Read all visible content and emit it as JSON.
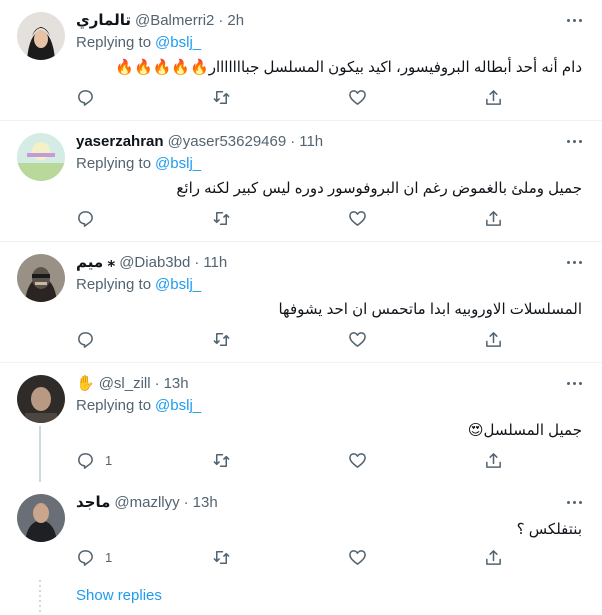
{
  "replying_label": "Replying to",
  "show_replies": "Show replies",
  "tweets": [
    {
      "name": "تالماري",
      "handle": "@Balmerri2",
      "time": "2h",
      "reply_to": "@bslj_",
      "text": "دام أنه أحد أبطاله البروفيسور، اكيد بيكون المسلسل جبااااااار🔥🔥🔥🔥🔥",
      "replies": "",
      "avatar_bg": "#d8d4cf"
    },
    {
      "name": "yaserzahran",
      "handle": "@yaser53629469",
      "time": "11h",
      "reply_to": "@bslj_",
      "text": "جميل وملئ بالغموض رغم ان البروفوسور دوره ليس كبير لكنه رائع",
      "replies": "",
      "avatar_bg": "#cfe9df"
    },
    {
      "name": "ميم ⁎",
      "handle": "@Diab3bd",
      "time": "11h",
      "reply_to": "@bslj_",
      "text": "المسلسلات الاوروبيه ابدا ماتحمس ان احد يشوفها",
      "replies": "",
      "avatar_bg": "#8b8378"
    },
    {
      "name": "",
      "handle": "@sl_zill",
      "time": "13h",
      "reply_to": "@bslj_",
      "text": "جميل المسلسل😍",
      "replies": "1",
      "avatar_bg": "#2d2a28"
    },
    {
      "name": "ماجد",
      "handle": "@mazllyy",
      "time": "13h",
      "reply_to": "",
      "text": "بنتفلكس ؟",
      "replies": "1",
      "avatar_bg": "#4a4e56"
    }
  ],
  "colors": {
    "link": "#1d9bf0",
    "secondary_text": "#536471",
    "divider": "#eff3f4",
    "thread_line": "#cfd9de"
  }
}
